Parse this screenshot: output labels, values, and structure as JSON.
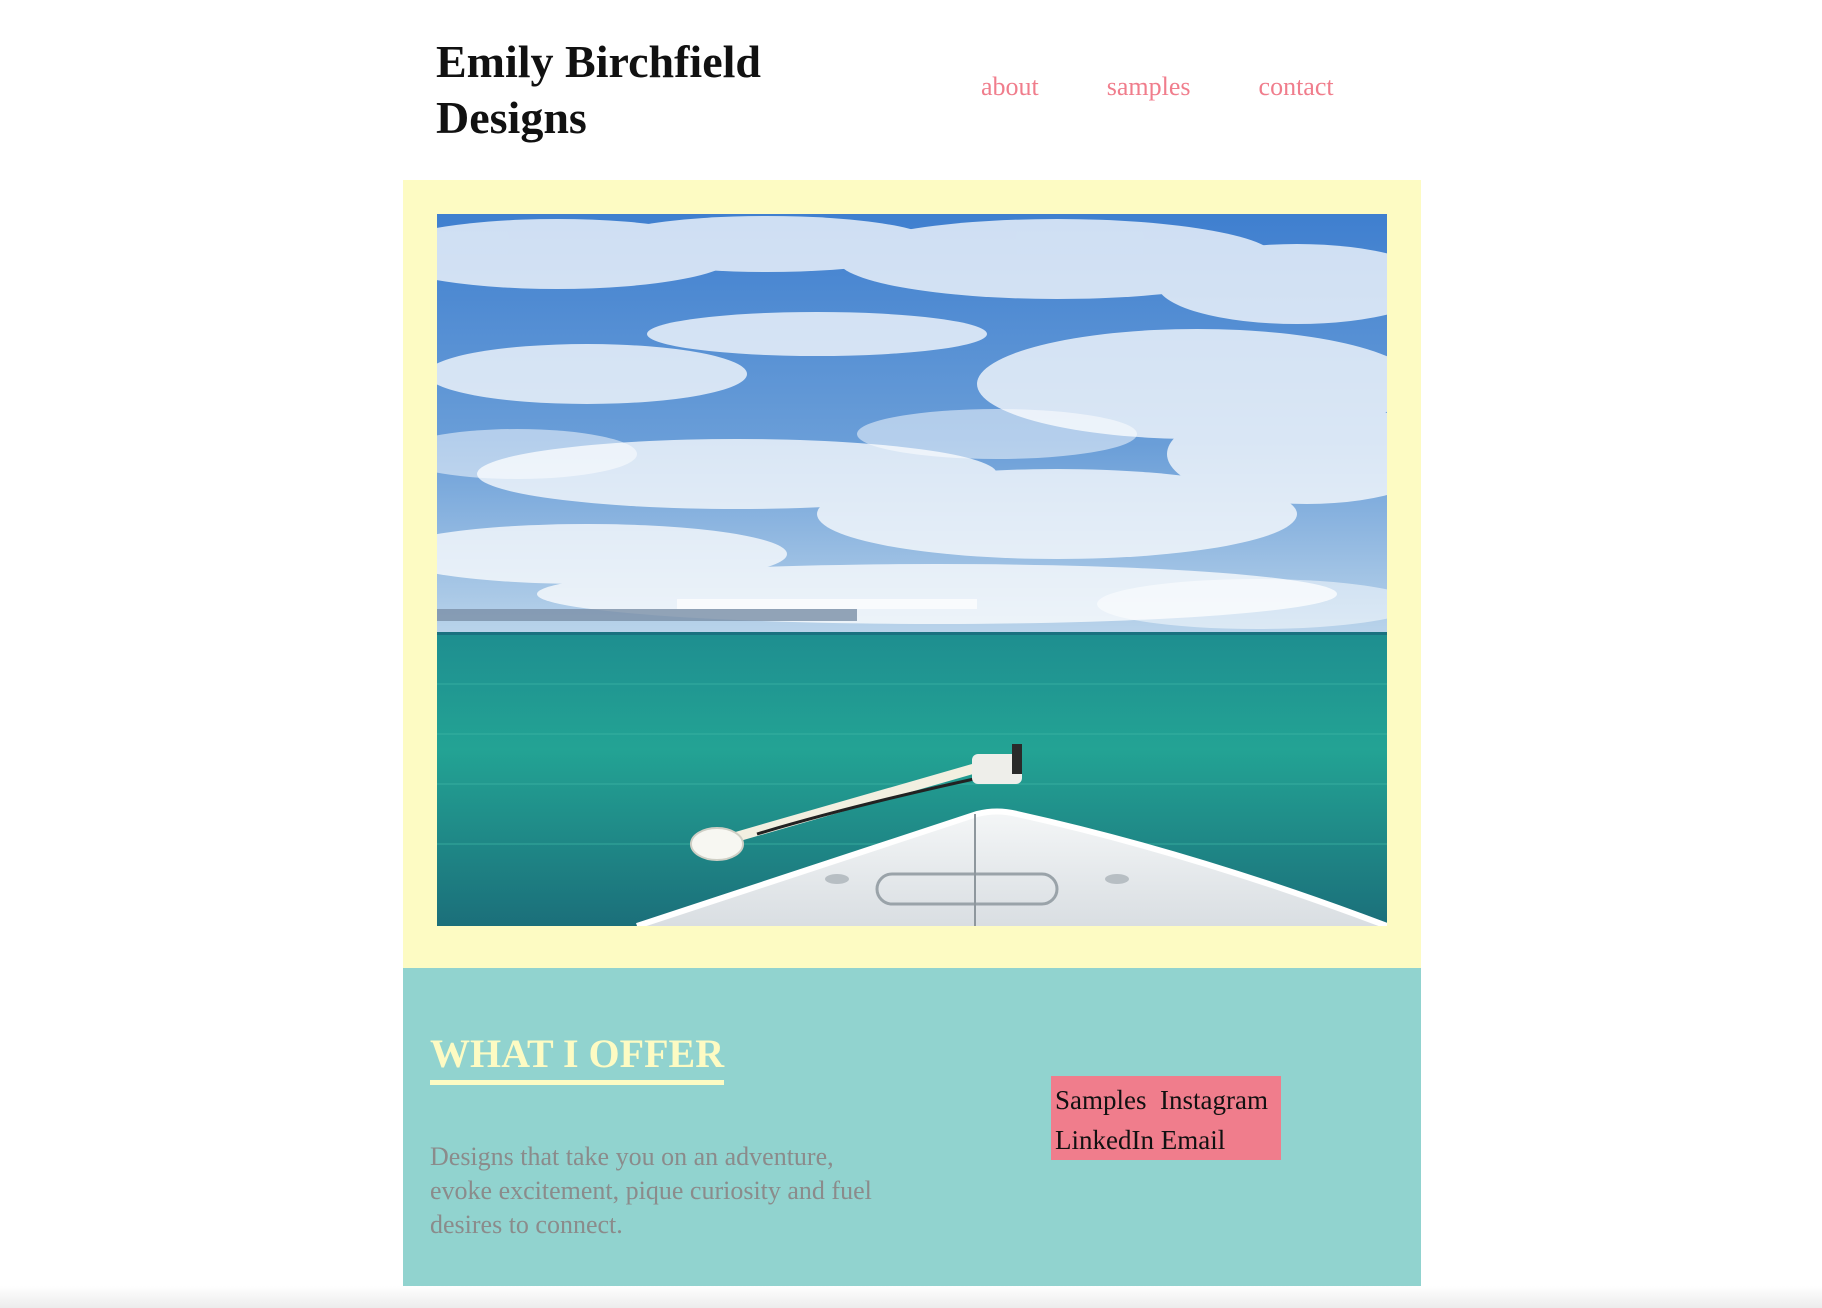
{
  "header": {
    "title": "Emily Birchfield Designs",
    "nav": {
      "about": "about",
      "samples": "samples",
      "contact": "contact"
    }
  },
  "hero": {
    "image_description_icon": "ocean-boat-photo"
  },
  "offer": {
    "heading": "WHAT I OFFER",
    "text": "Designs that take you on an adventure, evoke excitement, pique curiosity and fuel desires to connect.",
    "links": {
      "samples": "Samples",
      "instagram": "Instagram",
      "linkedin": "LinkedIn",
      "email": "Email"
    }
  },
  "colors": {
    "accent_pink": "#f07d8c",
    "hero_bg_yellow": "#fdfbc3",
    "offer_bg_teal": "#91d3cf",
    "body_text_gray": "#8b8b8b"
  }
}
